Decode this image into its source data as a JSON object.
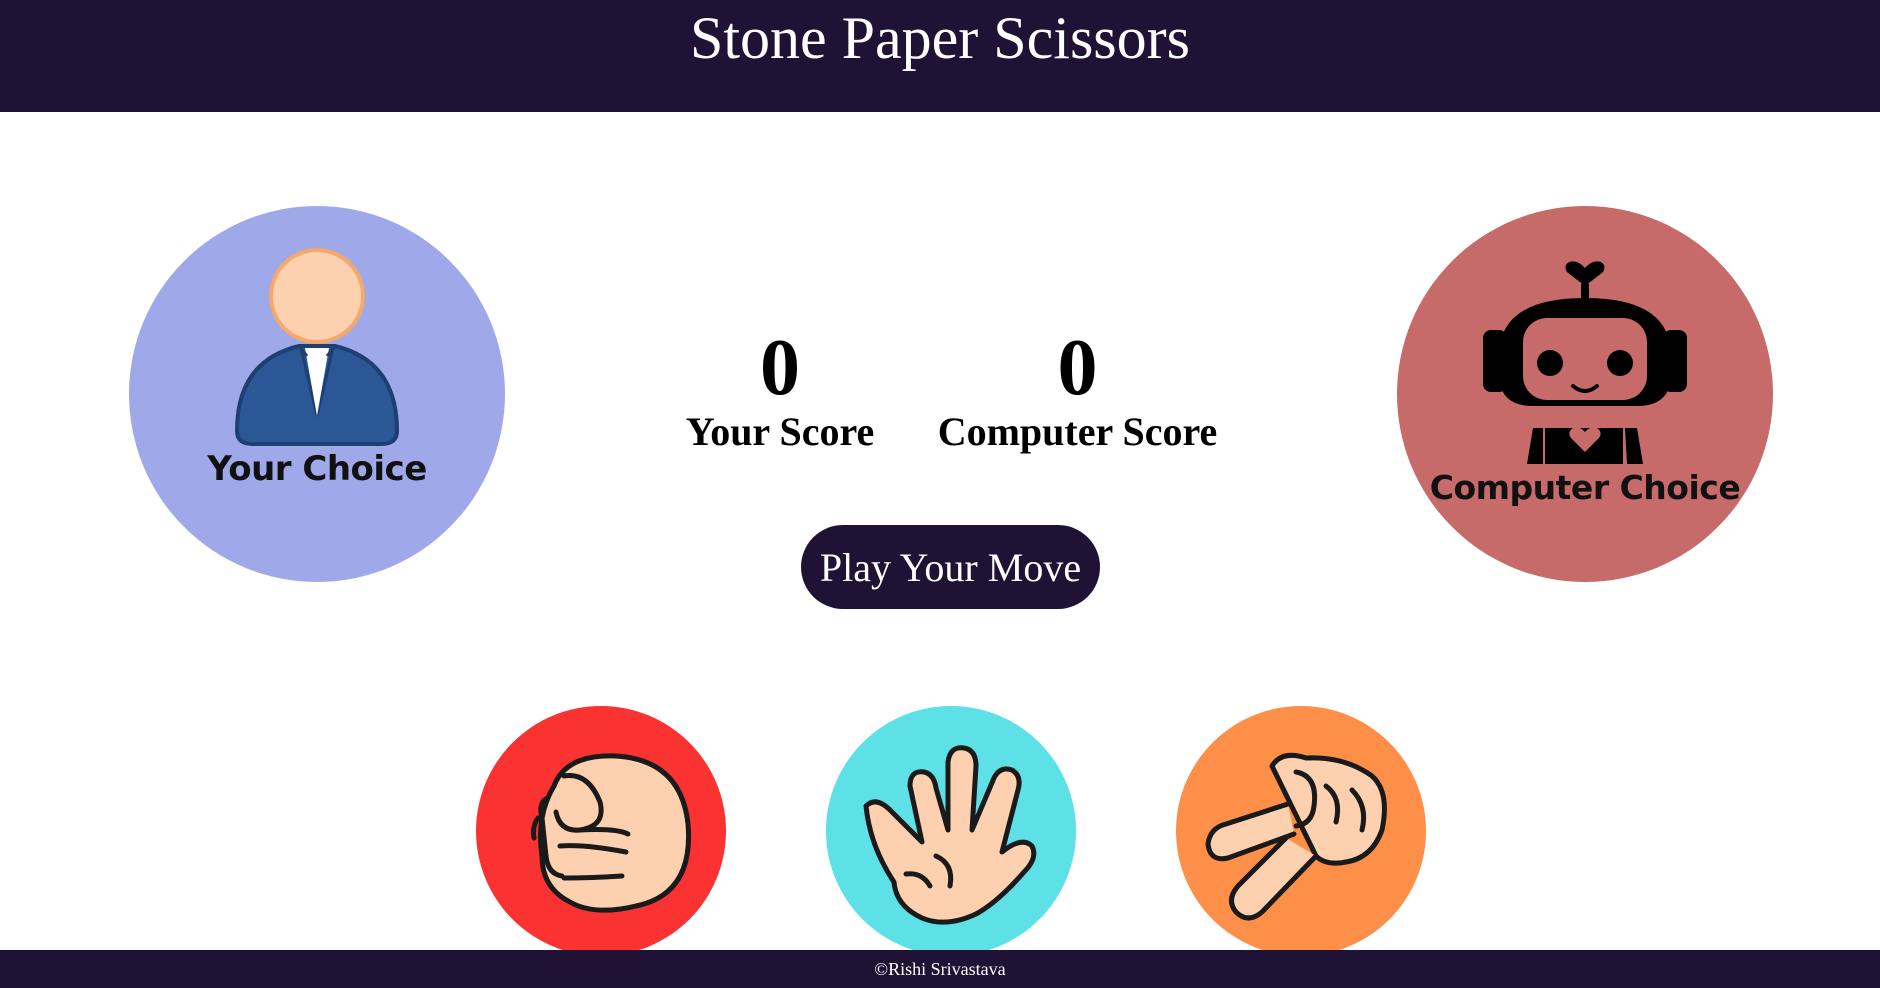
{
  "header": {
    "title": "Stone Paper Scissors"
  },
  "user_choice": {
    "label": "Your Choice",
    "icon": "person-icon",
    "color": "#9fa9ea"
  },
  "computer_choice": {
    "label": "Computer Choice",
    "icon": "robot-icon",
    "color": "#c66b6a"
  },
  "scoreboard": {
    "user_score": "0",
    "user_label": "Your Score",
    "computer_score": "0",
    "computer_label": "Computer Score"
  },
  "play_button": {
    "label": "Play Your Move"
  },
  "moves": [
    {
      "name": "stone",
      "icon": "fist-icon",
      "color": "#fa3232"
    },
    {
      "name": "paper",
      "icon": "open-hand-icon",
      "color": "#5de0e6"
    },
    {
      "name": "scissors",
      "icon": "scissors-hand-icon",
      "color": "#fe8f48"
    }
  ],
  "footer": {
    "text": "©Rishi Srivastava"
  },
  "colors": {
    "header_bg": "#201235",
    "skin": "#fdd1b0",
    "suit": "#2b5797"
  }
}
